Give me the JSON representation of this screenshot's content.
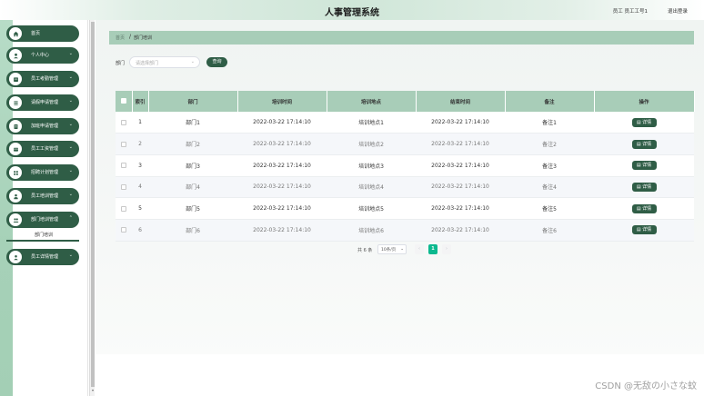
{
  "header": {
    "title": "人事管理系统",
    "user": "员工 员工工号1",
    "logout": "退出登录"
  },
  "sidebar": {
    "items": [
      {
        "label": "首页",
        "icon": "home-icon",
        "has_arrow": false
      },
      {
        "label": "个人中心",
        "icon": "user-icon",
        "has_arrow": true
      },
      {
        "label": "员工考勤管理",
        "icon": "calendar-icon",
        "has_arrow": true
      },
      {
        "label": "请假申请管理",
        "icon": "list-icon",
        "has_arrow": true
      },
      {
        "label": "加班申请管理",
        "icon": "document-icon",
        "has_arrow": true
      },
      {
        "label": "员工工资管理",
        "icon": "wallet-icon",
        "has_arrow": true
      },
      {
        "label": "招聘计划管理",
        "icon": "grid-icon",
        "has_arrow": true
      },
      {
        "label": "员工培训管理",
        "icon": "person-icon",
        "has_arrow": true
      },
      {
        "label": "部门培训管理",
        "icon": "team-icon",
        "has_arrow": true,
        "expanded": true
      },
      {
        "label": "员工详情管理",
        "icon": "profile-icon",
        "has_arrow": true
      }
    ],
    "active_subitem": "部门培训"
  },
  "breadcrumb": {
    "home": "首页",
    "separator": "/",
    "current": "部门培训"
  },
  "search": {
    "label": "部门",
    "placeholder": "请选择部门",
    "query_button": "查询"
  },
  "table": {
    "columns": [
      "索引",
      "部门",
      "培训时间",
      "培训地点",
      "结束时间",
      "备注",
      "操作"
    ],
    "rows": [
      {
        "index": "1",
        "dept": "部门1",
        "train_time": "2022-03-22 17:14:10",
        "location": "培训地点1",
        "end_time": "2022-03-22 17:14:10",
        "note": "备注1",
        "action": "详情"
      },
      {
        "index": "2",
        "dept": "部门2",
        "train_time": "2022-03-22 17:14:10",
        "location": "培训地点2",
        "end_time": "2022-03-22 17:14:10",
        "note": "备注2",
        "action": "详情"
      },
      {
        "index": "3",
        "dept": "部门3",
        "train_time": "2022-03-22 17:14:10",
        "location": "培训地点3",
        "end_time": "2022-03-22 17:14:10",
        "note": "备注3",
        "action": "详情"
      },
      {
        "index": "4",
        "dept": "部门4",
        "train_time": "2022-03-22 17:14:10",
        "location": "培训地点4",
        "end_time": "2022-03-22 17:14:10",
        "note": "备注4",
        "action": "详情"
      },
      {
        "index": "5",
        "dept": "部门5",
        "train_time": "2022-03-22 17:14:10",
        "location": "培训地点5",
        "end_time": "2022-03-22 17:14:10",
        "note": "备注5",
        "action": "详情"
      },
      {
        "index": "6",
        "dept": "部门6",
        "train_time": "2022-03-22 17:14:10",
        "location": "培训地点6",
        "end_time": "2022-03-22 17:14:10",
        "note": "备注6",
        "action": "详情"
      }
    ]
  },
  "pagination": {
    "total": "共 6 条",
    "page_size": "10条/页",
    "prev": "‹",
    "current": "1",
    "next": "›"
  },
  "watermark": "CSDN @无敌の小さな蚊",
  "colors": {
    "primary": "#2f5d46",
    "header_bg": "#a8cdb8",
    "page_active": "#0cb98f"
  }
}
